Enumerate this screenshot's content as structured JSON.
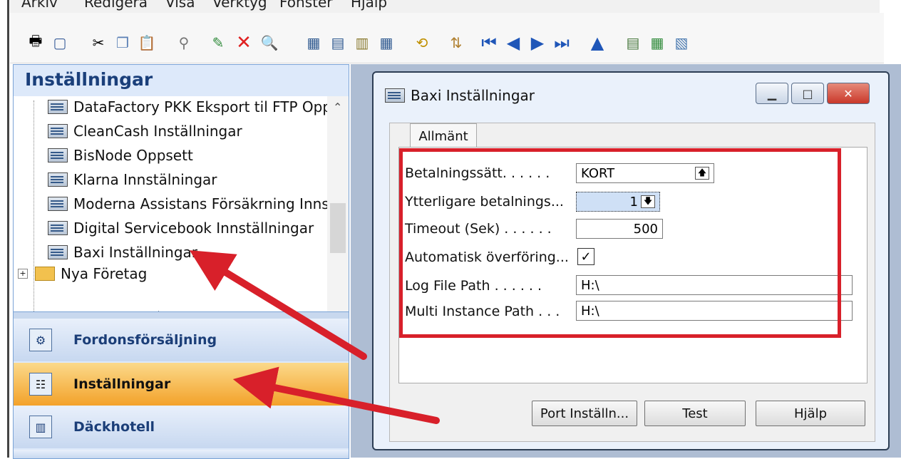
{
  "menu": [
    "Arkiv",
    "Redigera",
    "Visa",
    "Verktyg",
    "Fönster",
    "Hjälp"
  ],
  "toolbar_icons": [
    "print-icon",
    "preview-icon",
    "cut-icon",
    "copy-icon",
    "paste-icon",
    "attach-icon",
    "new-icon",
    "delete-icon",
    "find-icon",
    "list-icon",
    "card-icon",
    "matrix-icon",
    "table-icon",
    "refresh-icon",
    "sort-icon",
    "first-icon",
    "prev-icon",
    "next-icon",
    "last-icon",
    "up-icon",
    "report-icon",
    "excel-icon",
    "export-icon"
  ],
  "left_pane": {
    "title": "Inställningar",
    "tree_items": [
      "DataFactory PKK Eksport til FTP Opp",
      "CleanCash Inställningar",
      "BisNode Oppsett",
      "Klarna Innstälningar",
      "Moderna Assistans Försäkrning Inns",
      "Digital Servicebook Innställningar",
      "Baxi Inställningar",
      "Nya Företag"
    ],
    "nav_buttons": [
      "Fordonsförsäljning",
      "Inställningar",
      "Däckhotell"
    ]
  },
  "window": {
    "title": "Baxi Inställningar",
    "tab_label": "Allmänt",
    "fields": {
      "betalningssatt_label": "Betalningssätt. . . . . .",
      "betalningssatt_value": "KORT",
      "ytterligare_label": "Ytterligare betalnings...",
      "ytterligare_value": "1",
      "timeout_label": "Timeout (Sek) . . . . . .",
      "timeout_value": "500",
      "automatisk_label": "Automatisk överföring...",
      "automatisk_checked": true,
      "logpath_label": "Log File Path . . . . . .",
      "logpath_value": "H:\\",
      "multipath_label": "Multi Instance Path . . .",
      "multipath_value": "H:\\"
    },
    "buttons": {
      "port": "Port Inställn...",
      "test": "Test",
      "help": "Hjälp"
    }
  },
  "colors": {
    "annotation_red": "#d8202a",
    "selected_nav": "#f5a623"
  }
}
